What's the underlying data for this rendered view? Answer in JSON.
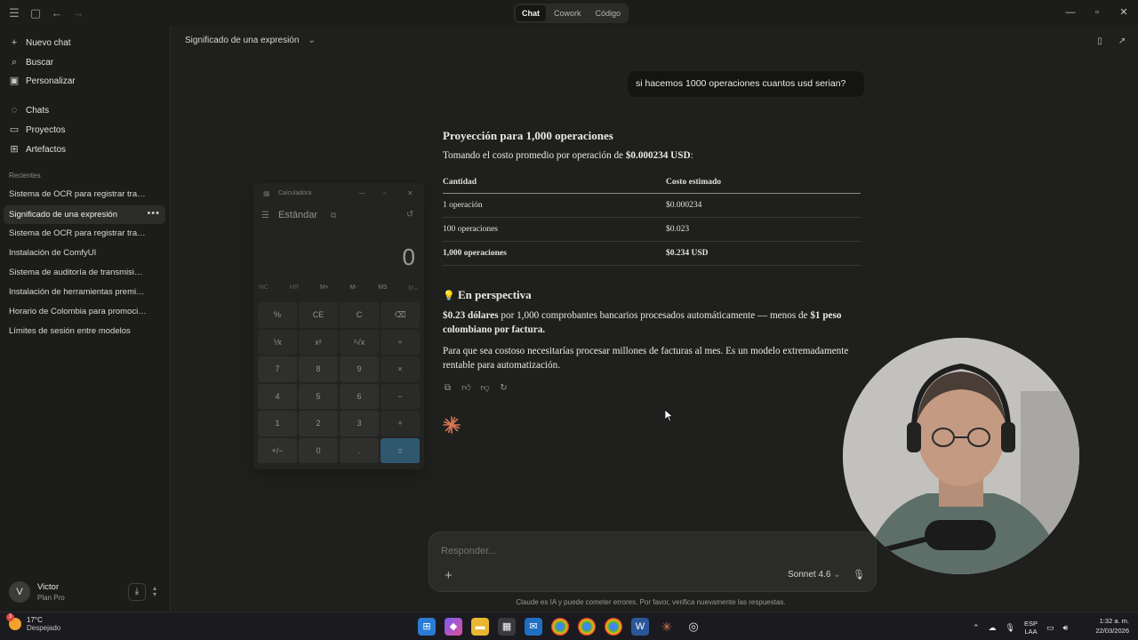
{
  "titlebar": {
    "tabs": [
      "Chat",
      "Cowork",
      "Código"
    ],
    "active_tab": "Chat"
  },
  "sidebar": {
    "nav": [
      {
        "label": "Nuevo chat",
        "icon": "plus-icon"
      },
      {
        "label": "Buscar",
        "icon": "search-icon"
      },
      {
        "label": "Personalizar",
        "icon": "briefcase-icon"
      },
      {
        "label": "Chats",
        "icon": "chat-bubble-icon"
      },
      {
        "label": "Proyectos",
        "icon": "folder-icon"
      },
      {
        "label": "Artefactos",
        "icon": "grid-icon"
      }
    ],
    "recents_label": "Recientes",
    "recents": [
      "Sistema de OCR para registrar tra…",
      "Significado de una expresión",
      "Sistema de OCR para registrar tra…",
      "Instalación de ComfyUI",
      "Sistema de auditoría de transmisi…",
      "Instalación de herramientas premi…",
      "Horario de Colombia para promoci…",
      "Límites de sesión entre modelos"
    ],
    "active_recent_index": 1,
    "user": {
      "initial": "V",
      "name": "Victor",
      "plan": "Plan Pro"
    }
  },
  "chat": {
    "title": "Significado de una expresión",
    "user_message": "si hacemos 1000 operaciones cuantos usd serian?",
    "heading": "Proyección para 1,000 operaciones",
    "intro_prefix": "Tomando el costo promedio por operación de ",
    "intro_value": "$0.000234 USD",
    "intro_suffix": ":",
    "table": {
      "headers": [
        "Cantidad",
        "Costo estimado"
      ],
      "rows": [
        [
          "1 operación",
          "$0.000234"
        ],
        [
          "100 operaciones",
          "$0.023"
        ],
        [
          "1,000 operaciones",
          "$0.234 USD"
        ]
      ]
    },
    "perspective_icon": "💡",
    "perspective_heading": "En perspectiva",
    "perspective_p1_bold": "$0.23 dólares",
    "perspective_p1_rest": " por 1,000 comprobantes bancarios procesados automáticamente — menos de ",
    "perspective_p1_bold2": "$1 peso colombiano por factura.",
    "perspective_p2": "Para que sea costoso necesitarías procesar millones de facturas al mes. Es un modelo extremadamente rentable para automatización."
  },
  "composer": {
    "placeholder": "Responder...",
    "model": "Sonnet 4.6",
    "disclaimer": "Claude es IA y puede cometer errores. Por favor, verifica nuevamente las respuestas."
  },
  "calculator": {
    "title": "Calculadora",
    "mode": "Estándar",
    "display": "0",
    "memory": [
      "MC",
      "MR",
      "M+",
      "M-",
      "MS",
      "M⌄"
    ],
    "keys": [
      "%",
      "CE",
      "C",
      "⌫",
      "⅟x",
      "x²",
      "²√x",
      "÷",
      "7",
      "8",
      "9",
      "×",
      "4",
      "5",
      "6",
      "−",
      "1",
      "2",
      "3",
      "+",
      "+/−",
      "0",
      ".",
      "="
    ]
  },
  "taskbar": {
    "weather_badge": "3",
    "temperature": "17°C",
    "condition": "Despejado",
    "lang_top": "ESP",
    "lang_bottom": "LAA",
    "time": "1:32 a. m.",
    "date": "22/03/2026"
  },
  "colors": {
    "background": "#1f1f1e",
    "accent_claude": "#d97757",
    "calc_equals": "#3b7fa6"
  }
}
